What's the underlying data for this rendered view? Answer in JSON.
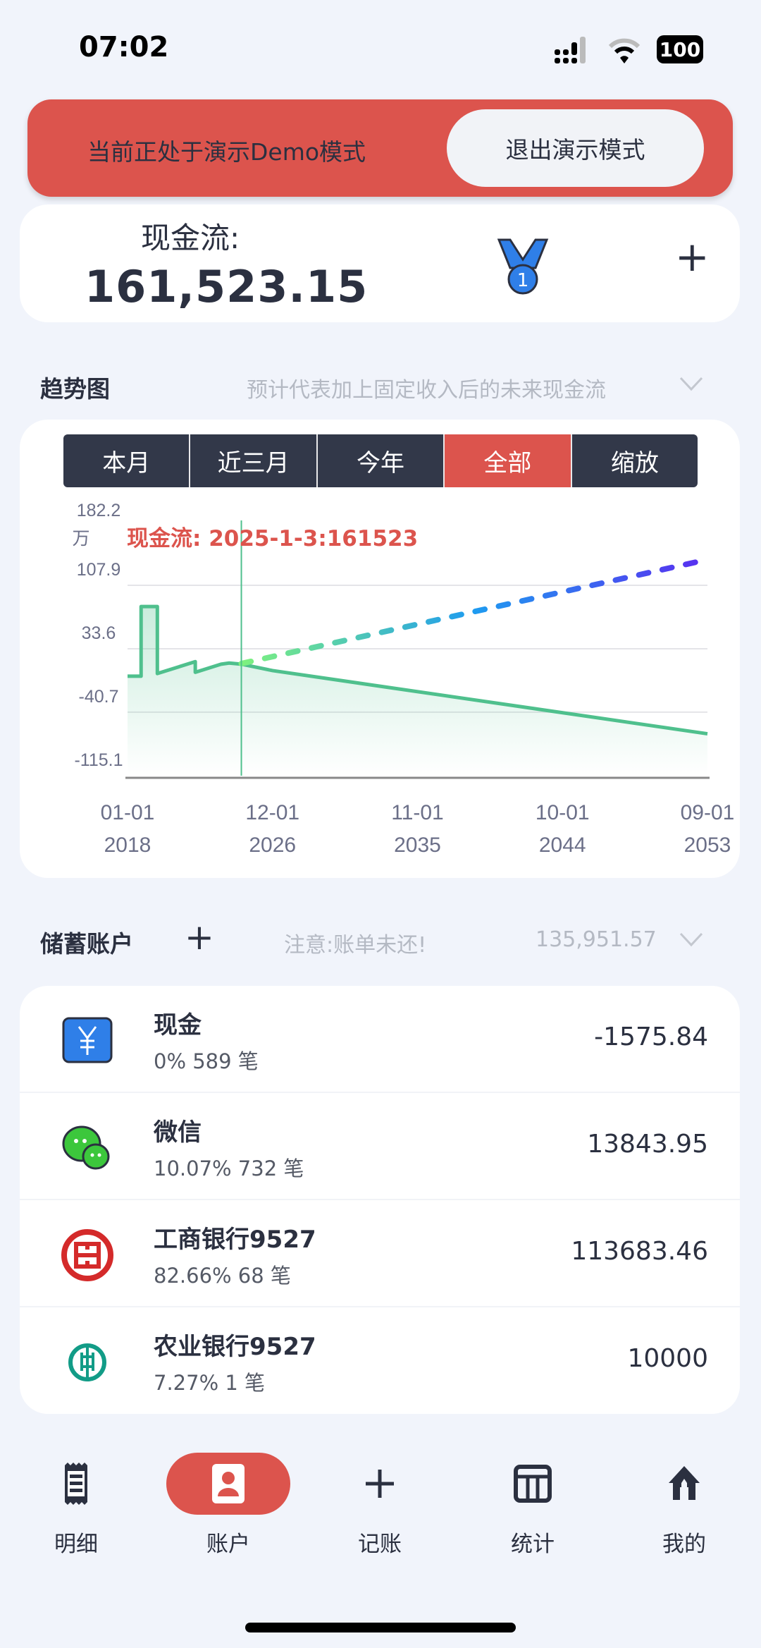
{
  "status_bar": {
    "time": "07:02",
    "battery": "100"
  },
  "banner": {
    "text": "当前正处于演示Demo模式",
    "exit_label": "退出演示模式",
    "color": "#dc544d"
  },
  "cash": {
    "label": "现金流:",
    "amount": "161,523.15",
    "medal_number": "1"
  },
  "trend": {
    "title": "趋势图",
    "hint": "预计代表加上固定收入后的未来现金流",
    "tabs": [
      {
        "label": "本月"
      },
      {
        "label": "近三月"
      },
      {
        "label": "今年"
      },
      {
        "label": "全部",
        "active": true
      },
      {
        "label": "缩放"
      }
    ]
  },
  "chart_data": {
    "type": "line",
    "unit_label": "万",
    "tooltip": "现金流: 2025-1-3:161523",
    "ylim": [
      -115.1,
      182.2
    ],
    "yticks": [
      "182.2",
      "107.9",
      "33.6",
      "-40.7",
      "-115.1"
    ],
    "xlim": [
      "2018-01",
      "2053-09"
    ],
    "xticks": [
      {
        "md": "01-01",
        "y": "2018"
      },
      {
        "md": "12-01",
        "y": "2026"
      },
      {
        "md": "11-01",
        "y": "2035"
      },
      {
        "md": "10-01",
        "y": "2044"
      },
      {
        "md": "09-01",
        "y": "2053"
      }
    ],
    "cursor_date": "2025-01",
    "series": [
      {
        "style": "solid",
        "color": "#4fc08d",
        "points": [
          [
            "2018-01",
            1.4
          ],
          [
            "2018-11",
            1.4
          ],
          [
            "2018-11",
            83
          ],
          [
            "2019-11",
            83
          ],
          [
            "2019-11",
            4.5
          ],
          [
            "2022-03",
            18.5
          ],
          [
            "2022-03",
            6
          ],
          [
            "2023-10",
            15.5
          ],
          [
            "2024-04",
            16.8
          ],
          [
            "2025-01",
            15.5
          ],
          [
            "2026-12",
            8
          ],
          [
            "2053-09",
            -66
          ]
        ]
      },
      {
        "style": "dashed",
        "colors": [
          "#7ef27e",
          "#1e9bf0",
          "#5a2df0"
        ],
        "points": [
          [
            "2025-01",
            16.2
          ],
          [
            "2053-09",
            138
          ]
        ]
      }
    ],
    "grid": true
  },
  "savings": {
    "title": "储蓄账户",
    "notice": "注意:账单未还!",
    "total": "135,951.57"
  },
  "accounts": [
    {
      "name": "现金",
      "sub": "0% 589 笔",
      "amount": "-1575.84",
      "icon": "yuan-icon"
    },
    {
      "name": "微信",
      "sub": "10.07% 732 笔",
      "amount": "13843.95",
      "icon": "wechat-icon"
    },
    {
      "name": "工商银行9527",
      "sub": "82.66% 68 笔",
      "amount": "113683.46",
      "icon": "icbc-icon"
    },
    {
      "name": "农业银行9527",
      "sub": "7.27% 1 笔",
      "amount": "10000",
      "icon": "abc-bank-icon"
    }
  ],
  "nav": [
    {
      "label": "明细"
    },
    {
      "label": "账户",
      "active": true
    },
    {
      "label": "记账"
    },
    {
      "label": "统计"
    },
    {
      "label": "我的"
    }
  ]
}
